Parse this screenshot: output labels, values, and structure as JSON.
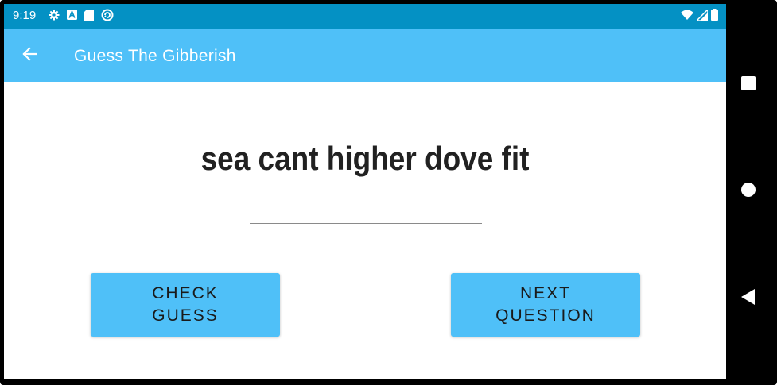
{
  "status_bar": {
    "time": "9:19",
    "icons_left": [
      "settings-icon",
      "a-badge-icon",
      "sd-card-icon",
      "sync-circle-icon"
    ],
    "icons_right": [
      "wifi-icon",
      "signal-icon",
      "battery-icon"
    ],
    "color": "#0491c4"
  },
  "app_bar": {
    "title": "Guess The Gibberish",
    "back_icon": "arrow-left-icon",
    "color": "#4fc0f8"
  },
  "main": {
    "gibberish_text": "sea cant higher dove fit",
    "guess_input": {
      "value": "",
      "placeholder": ""
    },
    "check_button_label": "CHECK GUESS",
    "next_button_label": "NEXT QUESTION",
    "button_color": "#4fc0f8"
  },
  "nav_bar": {
    "buttons": [
      "recents-square-icon",
      "home-circle-icon",
      "back-triangle-icon"
    ]
  }
}
